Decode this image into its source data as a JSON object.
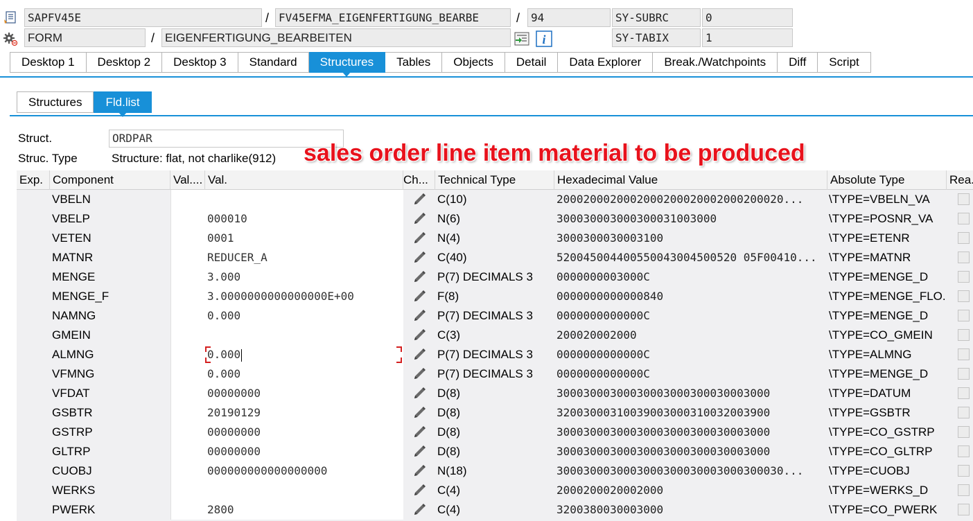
{
  "header": {
    "row1": {
      "program": "SAPFV45E",
      "sep1": "/",
      "include": "FV45EFMA_EIGENFERTIGUNG_BEARBE",
      "sep2": "/",
      "line": "94",
      "sysvar_label": "SY-SUBRC",
      "sysvar_value": "0"
    },
    "row2": {
      "event_type": "FORM",
      "sep1": "/",
      "event_name": "EIGENFERTIGUNG_BEARBEITEN",
      "sysvar_label": "SY-TABIX",
      "sysvar_value": "1"
    }
  },
  "tabs": [
    {
      "label": "Desktop 1"
    },
    {
      "label": "Desktop 2"
    },
    {
      "label": "Desktop 3"
    },
    {
      "label": "Standard"
    },
    {
      "label": "Structures",
      "active": true
    },
    {
      "label": "Tables"
    },
    {
      "label": "Objects"
    },
    {
      "label": "Detail"
    },
    {
      "label": "Data Explorer"
    },
    {
      "label": "Break./Watchpoints"
    },
    {
      "label": "Diff"
    },
    {
      "label": "Script"
    }
  ],
  "subtabs": [
    {
      "label": "Structures"
    },
    {
      "label": "Fld.list",
      "active": true
    }
  ],
  "struct": {
    "struct_label": "Struct.",
    "struct_value": "ORDPAR",
    "type_label": "Struc. Type",
    "type_value": "Structure: flat, not charlike(912)"
  },
  "annotation": "sales order line item material to be produced",
  "table": {
    "headers": {
      "exp": "Exp.",
      "component": "Component",
      "valcol": "Val....",
      "val": "Val.",
      "ch": "Ch...",
      "tech": "Technical Type",
      "hex": "Hexadecimal Value",
      "abs": "Absolute Type",
      "rea": "Rea."
    },
    "rows": [
      {
        "component": "VBELN",
        "value": "",
        "tech": "C(10)",
        "hex": "2000200020002000200020002000200020...",
        "abs": "\\TYPE=VBELN_VA"
      },
      {
        "component": "VBELP",
        "value": "000010",
        "tech": "N(6)",
        "hex": "300030003000300031003000",
        "abs": "\\TYPE=POSNR_VA"
      },
      {
        "component": "VETEN",
        "value": "0001",
        "tech": "N(4)",
        "hex": "3000300030003100",
        "abs": "\\TYPE=ETENR"
      },
      {
        "component": "MATNR",
        "value": "REDUCER_A",
        "tech": "C(40)",
        "hex": "520045004400550043004500520 05F00410...",
        "abs": "\\TYPE=MATNR"
      },
      {
        "component": "MENGE",
        "value": "3.000",
        "tech": "P(7) DECIMALS 3",
        "hex": "0000000003000C",
        "abs": "\\TYPE=MENGE_D"
      },
      {
        "component": "MENGE_F",
        "value": "3.0000000000000000E+00",
        "tech": "F(8)",
        "hex": "0000000000000840",
        "abs": "\\TYPE=MENGE_FLO..."
      },
      {
        "component": "NAMNG",
        "value": "0.000",
        "tech": "P(7) DECIMALS 3",
        "hex": "0000000000000C",
        "abs": "\\TYPE=MENGE_D"
      },
      {
        "component": "GMEIN",
        "value": "",
        "tech": "C(3)",
        "hex": "200020002000",
        "abs": "\\TYPE=CO_GMEIN"
      },
      {
        "component": "ALMNG",
        "value": "0.000",
        "tech": "P(7) DECIMALS 3",
        "hex": "0000000000000C",
        "abs": "\\TYPE=ALMNG",
        "focused": true
      },
      {
        "component": "VFMNG",
        "value": "0.000",
        "tech": "P(7) DECIMALS 3",
        "hex": "0000000000000C",
        "abs": "\\TYPE=MENGE_D"
      },
      {
        "component": "VFDAT",
        "value": "00000000",
        "tech": "D(8)",
        "hex": "30003000300030003000300030003000",
        "abs": "\\TYPE=DATUM"
      },
      {
        "component": "GSBTR",
        "value": "20190129",
        "tech": "D(8)",
        "hex": "32003000310039003000310032003900",
        "abs": "\\TYPE=GSBTR"
      },
      {
        "component": "GSTRP",
        "value": "00000000",
        "tech": "D(8)",
        "hex": "30003000300030003000300030003000",
        "abs": "\\TYPE=CO_GSTRP"
      },
      {
        "component": "GLTRP",
        "value": "00000000",
        "tech": "D(8)",
        "hex": "30003000300030003000300030003000",
        "abs": "\\TYPE=CO_GLTRP"
      },
      {
        "component": "CUOBJ",
        "value": "000000000000000000",
        "tech": "N(18)",
        "hex": "3000300030003000300030003000300030...",
        "abs": "\\TYPE=CUOBJ"
      },
      {
        "component": "WERKS",
        "value": "",
        "tech": "C(4)",
        "hex": "2000200020002000",
        "abs": "\\TYPE=WERKS_D"
      },
      {
        "component": "PWERK",
        "value": "2800",
        "tech": "C(4)",
        "hex": "3200380030003000",
        "abs": "\\TYPE=CO_PWERK"
      }
    ]
  },
  "icons": {
    "header_row1": "source-code-icon",
    "header_row2": "settings-gear-icon",
    "save": "transfer-icon",
    "info": "info-icon",
    "edit": "pencil-icon"
  },
  "colors": {
    "accent": "#1890d8",
    "annotation": "#e8121c",
    "focus": "#d42020"
  }
}
